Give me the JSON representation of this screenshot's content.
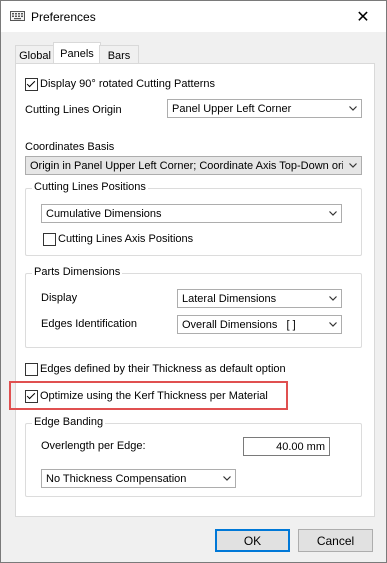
{
  "window": {
    "title": "Preferences",
    "close_glyph": "✕"
  },
  "tabs": [
    {
      "label": "Global",
      "active": false
    },
    {
      "label": "Panels",
      "active": true
    },
    {
      "label": "Bars",
      "active": false
    }
  ],
  "panels": {
    "display_rotated": {
      "label": "Display 90° rotated Cutting Patterns",
      "checked": true
    },
    "cutting_lines_origin": {
      "label": "Cutting Lines Origin",
      "value": "Panel Upper Left Corner"
    },
    "coordinates_basis": {
      "label": "Coordinates Basis",
      "value": "Origin in Panel Upper Left Corner; Coordinate Axis Top-Down orie"
    },
    "cutting_lines_positions": {
      "title": "Cutting Lines Positions",
      "value": "Cumulative Dimensions",
      "axis_positions": {
        "label": "Cutting Lines Axis Positions",
        "checked": false
      }
    },
    "parts_dimensions": {
      "title": "Parts Dimensions",
      "display_label": "Display",
      "display_value": "Lateral Dimensions",
      "edges_label": "Edges Identification",
      "edges_value": "Overall Dimensions   [ ]"
    },
    "edges_thickness": {
      "label": "Edges defined by their Thickness as default option",
      "checked": false
    },
    "optimize_kerf": {
      "label": "Optimize using the Kerf Thickness per Material",
      "checked": true
    },
    "edge_banding": {
      "title": "Edge Banding",
      "overlength_label": "Overlength per Edge:",
      "overlength_value": "40.00 mm",
      "compensation_value": "No Thickness Compensation"
    }
  },
  "buttons": {
    "ok": "OK",
    "cancel": "Cancel"
  },
  "colors": {
    "highlight": "#e05050",
    "default_button_border": "#0078d7"
  }
}
